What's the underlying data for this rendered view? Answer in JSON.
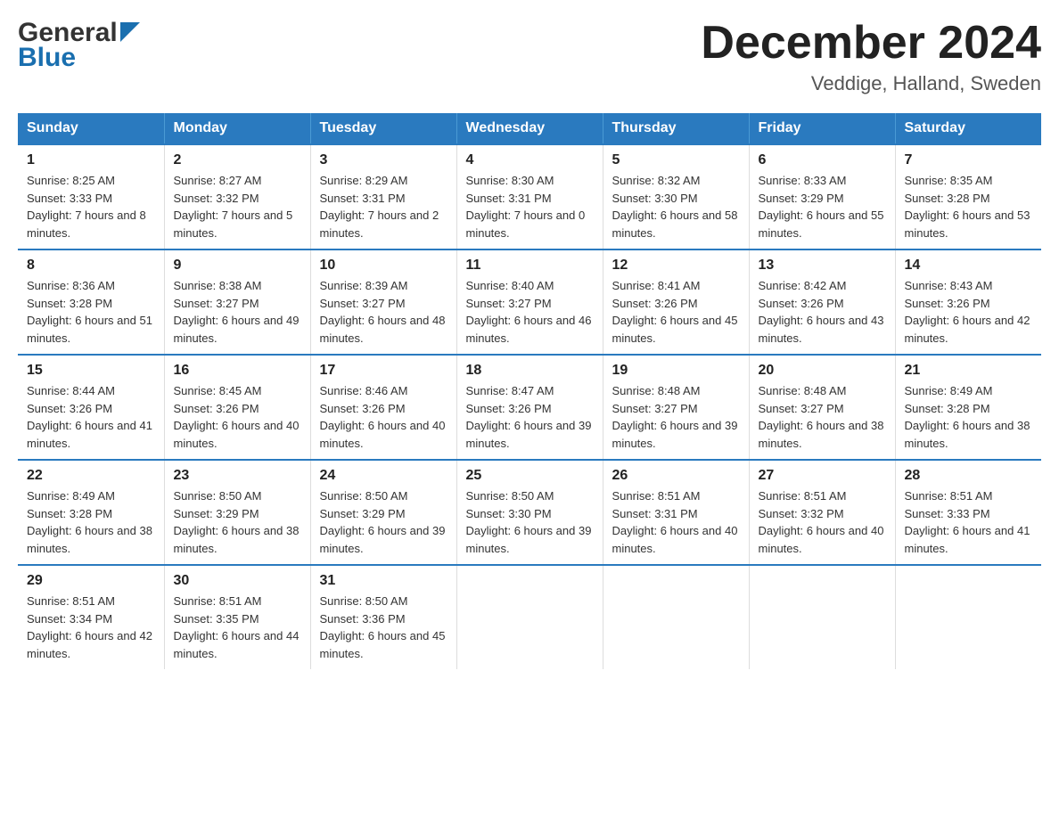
{
  "logo": {
    "general": "General",
    "blue": "Blue"
  },
  "title": {
    "month_year": "December 2024",
    "location": "Veddige, Halland, Sweden"
  },
  "calendar": {
    "headers": [
      "Sunday",
      "Monday",
      "Tuesday",
      "Wednesday",
      "Thursday",
      "Friday",
      "Saturday"
    ],
    "weeks": [
      [
        {
          "day": "1",
          "sunrise": "8:25 AM",
          "sunset": "3:33 PM",
          "daylight": "7 hours and 8 minutes."
        },
        {
          "day": "2",
          "sunrise": "8:27 AM",
          "sunset": "3:32 PM",
          "daylight": "7 hours and 5 minutes."
        },
        {
          "day": "3",
          "sunrise": "8:29 AM",
          "sunset": "3:31 PM",
          "daylight": "7 hours and 2 minutes."
        },
        {
          "day": "4",
          "sunrise": "8:30 AM",
          "sunset": "3:31 PM",
          "daylight": "7 hours and 0 minutes."
        },
        {
          "day": "5",
          "sunrise": "8:32 AM",
          "sunset": "3:30 PM",
          "daylight": "6 hours and 58 minutes."
        },
        {
          "day": "6",
          "sunrise": "8:33 AM",
          "sunset": "3:29 PM",
          "daylight": "6 hours and 55 minutes."
        },
        {
          "day": "7",
          "sunrise": "8:35 AM",
          "sunset": "3:28 PM",
          "daylight": "6 hours and 53 minutes."
        }
      ],
      [
        {
          "day": "8",
          "sunrise": "8:36 AM",
          "sunset": "3:28 PM",
          "daylight": "6 hours and 51 minutes."
        },
        {
          "day": "9",
          "sunrise": "8:38 AM",
          "sunset": "3:27 PM",
          "daylight": "6 hours and 49 minutes."
        },
        {
          "day": "10",
          "sunrise": "8:39 AM",
          "sunset": "3:27 PM",
          "daylight": "6 hours and 48 minutes."
        },
        {
          "day": "11",
          "sunrise": "8:40 AM",
          "sunset": "3:27 PM",
          "daylight": "6 hours and 46 minutes."
        },
        {
          "day": "12",
          "sunrise": "8:41 AM",
          "sunset": "3:26 PM",
          "daylight": "6 hours and 45 minutes."
        },
        {
          "day": "13",
          "sunrise": "8:42 AM",
          "sunset": "3:26 PM",
          "daylight": "6 hours and 43 minutes."
        },
        {
          "day": "14",
          "sunrise": "8:43 AM",
          "sunset": "3:26 PM",
          "daylight": "6 hours and 42 minutes."
        }
      ],
      [
        {
          "day": "15",
          "sunrise": "8:44 AM",
          "sunset": "3:26 PM",
          "daylight": "6 hours and 41 minutes."
        },
        {
          "day": "16",
          "sunrise": "8:45 AM",
          "sunset": "3:26 PM",
          "daylight": "6 hours and 40 minutes."
        },
        {
          "day": "17",
          "sunrise": "8:46 AM",
          "sunset": "3:26 PM",
          "daylight": "6 hours and 40 minutes."
        },
        {
          "day": "18",
          "sunrise": "8:47 AM",
          "sunset": "3:26 PM",
          "daylight": "6 hours and 39 minutes."
        },
        {
          "day": "19",
          "sunrise": "8:48 AM",
          "sunset": "3:27 PM",
          "daylight": "6 hours and 39 minutes."
        },
        {
          "day": "20",
          "sunrise": "8:48 AM",
          "sunset": "3:27 PM",
          "daylight": "6 hours and 38 minutes."
        },
        {
          "day": "21",
          "sunrise": "8:49 AM",
          "sunset": "3:28 PM",
          "daylight": "6 hours and 38 minutes."
        }
      ],
      [
        {
          "day": "22",
          "sunrise": "8:49 AM",
          "sunset": "3:28 PM",
          "daylight": "6 hours and 38 minutes."
        },
        {
          "day": "23",
          "sunrise": "8:50 AM",
          "sunset": "3:29 PM",
          "daylight": "6 hours and 38 minutes."
        },
        {
          "day": "24",
          "sunrise": "8:50 AM",
          "sunset": "3:29 PM",
          "daylight": "6 hours and 39 minutes."
        },
        {
          "day": "25",
          "sunrise": "8:50 AM",
          "sunset": "3:30 PM",
          "daylight": "6 hours and 39 minutes."
        },
        {
          "day": "26",
          "sunrise": "8:51 AM",
          "sunset": "3:31 PM",
          "daylight": "6 hours and 40 minutes."
        },
        {
          "day": "27",
          "sunrise": "8:51 AM",
          "sunset": "3:32 PM",
          "daylight": "6 hours and 40 minutes."
        },
        {
          "day": "28",
          "sunrise": "8:51 AM",
          "sunset": "3:33 PM",
          "daylight": "6 hours and 41 minutes."
        }
      ],
      [
        {
          "day": "29",
          "sunrise": "8:51 AM",
          "sunset": "3:34 PM",
          "daylight": "6 hours and 42 minutes."
        },
        {
          "day": "30",
          "sunrise": "8:51 AM",
          "sunset": "3:35 PM",
          "daylight": "6 hours and 44 minutes."
        },
        {
          "day": "31",
          "sunrise": "8:50 AM",
          "sunset": "3:36 PM",
          "daylight": "6 hours and 45 minutes."
        },
        null,
        null,
        null,
        null
      ]
    ]
  }
}
